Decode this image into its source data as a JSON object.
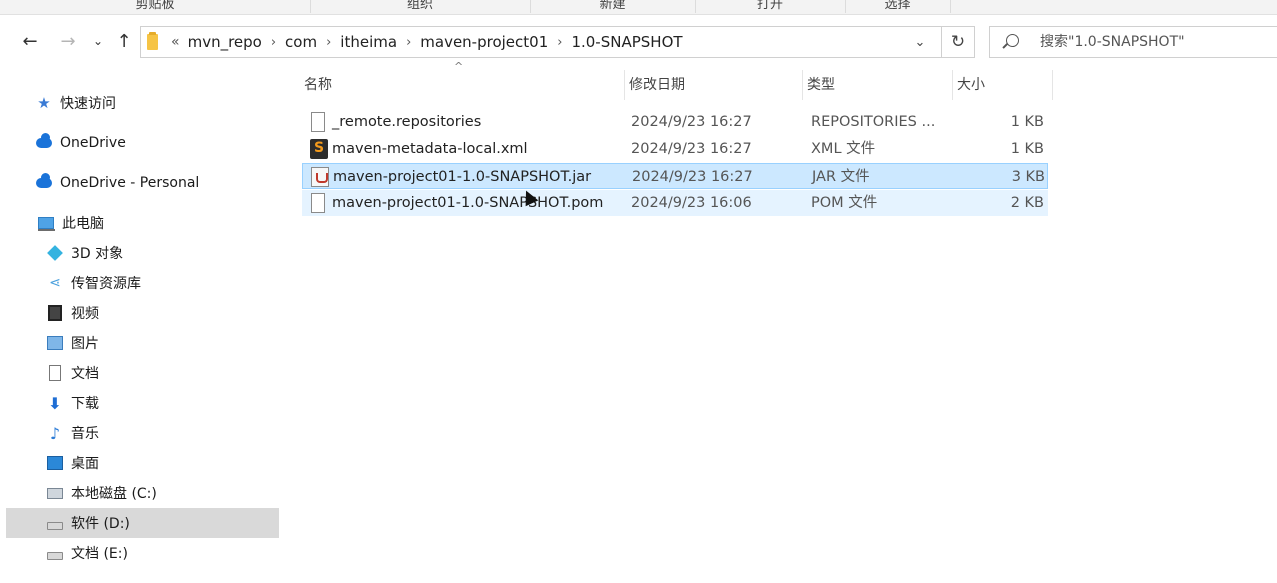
{
  "ribbon": {
    "groups": [
      "剪贴板",
      "组织",
      "新建",
      "打开",
      "选择"
    ]
  },
  "nav": {
    "back_icon": "arrow-left-icon",
    "forward_icon": "arrow-right-icon",
    "recent_icon": "chevron-down-icon",
    "up_icon": "arrow-up-icon"
  },
  "address": {
    "overflow": "«",
    "crumbs": [
      "mvn_repo",
      "com",
      "itheima",
      "maven-project01",
      "1.0-SNAPSHOT"
    ]
  },
  "search": {
    "placeholder": "搜索\"1.0-SNAPSHOT\""
  },
  "sidebar": {
    "items": [
      {
        "label": "快速访问",
        "icon": "star-icon"
      },
      {
        "label": "OneDrive",
        "icon": "cloud-icon"
      },
      {
        "label": "OneDrive - Personal",
        "icon": "cloud-icon"
      },
      {
        "label": "此电脑",
        "icon": "computer-icon"
      },
      {
        "label": "3D 对象",
        "icon": "cube-icon"
      },
      {
        "label": "传智资源库",
        "icon": "share-icon"
      },
      {
        "label": "视频",
        "icon": "video-icon"
      },
      {
        "label": "图片",
        "icon": "picture-icon"
      },
      {
        "label": "文档",
        "icon": "document-icon"
      },
      {
        "label": "下载",
        "icon": "download-icon"
      },
      {
        "label": "音乐",
        "icon": "music-icon"
      },
      {
        "label": "桌面",
        "icon": "desktop-icon"
      },
      {
        "label": "本地磁盘 (C:)",
        "icon": "drive-icon"
      },
      {
        "label": "软件 (D:)",
        "icon": "drive-icon"
      },
      {
        "label": "文档 (E:)",
        "icon": "drive-icon"
      }
    ]
  },
  "columns": {
    "name": "名称",
    "date": "修改日期",
    "type": "类型",
    "size": "大小"
  },
  "files": [
    {
      "name": "_remote.repositories",
      "date": "2024/9/23 16:27",
      "type": "REPOSITORIES ...",
      "size": "1 KB",
      "icon": "blank-file-icon"
    },
    {
      "name": "maven-metadata-local.xml",
      "date": "2024/9/23 16:27",
      "type": "XML 文件",
      "size": "1 KB",
      "icon": "sublime-file-icon"
    },
    {
      "name": "maven-project01-1.0-SNAPSHOT.jar",
      "date": "2024/9/23 16:27",
      "type": "JAR 文件",
      "size": "3 KB",
      "icon": "jar-file-icon"
    },
    {
      "name": "maven-project01-1.0-SNAPSHOT.pom",
      "date": "2024/9/23 16:06",
      "type": "POM 文件",
      "size": "2 KB",
      "icon": "blank-file-icon"
    }
  ]
}
